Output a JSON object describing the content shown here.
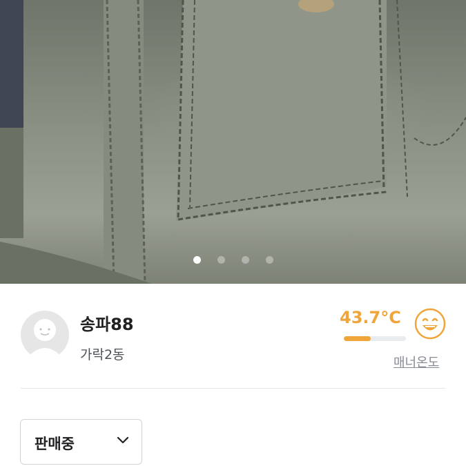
{
  "gallery": {
    "image": "jeans-back-pocket-photo",
    "slide_count": 4,
    "active_slide": 1
  },
  "seller": {
    "avatar": "default-avatar-icon",
    "name": "송파88",
    "location": "가락2동",
    "manner_temperature": "43.7°C",
    "manner_temperature_fraction": 0.437,
    "manner_label": "매너온도",
    "face_icon": "smiling-face-icon"
  },
  "status": {
    "selected": "판매중",
    "icon": "chevron-down-icon"
  },
  "colors": {
    "temperature": "#f0a53a",
    "text_primary": "#212124",
    "text_secondary": "#868b94"
  }
}
